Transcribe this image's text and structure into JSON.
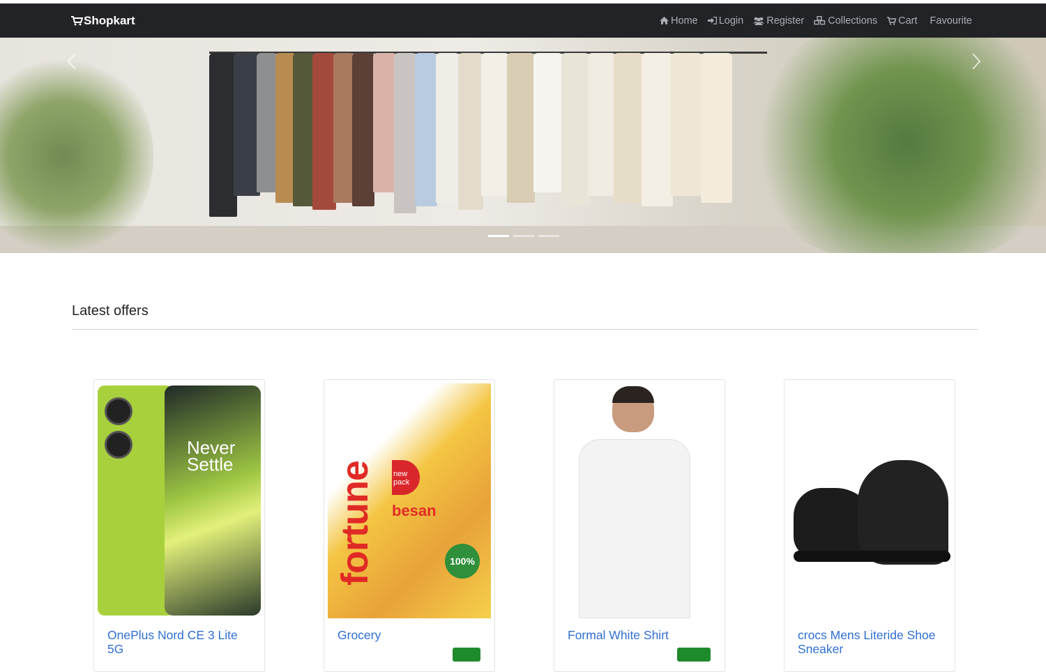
{
  "navbar": {
    "brand": "Shopkart",
    "links": [
      {
        "label": "Home",
        "icon": "home-icon"
      },
      {
        "label": "Login",
        "icon": "login-icon"
      },
      {
        "label": "Register",
        "icon": "users-icon"
      },
      {
        "label": "Collections",
        "icon": "cubes-icon"
      },
      {
        "label": "Cart",
        "icon": "cart-icon"
      },
      {
        "label": "Favourite",
        "icon": ""
      }
    ]
  },
  "carousel": {
    "slide_count": 3,
    "active_index": 0
  },
  "offers": {
    "heading": "Latest offers",
    "products": [
      {
        "title": "OnePlus Nord CE 3 Lite 5G",
        "image": "phone-product-image",
        "has_badge": false
      },
      {
        "title": "Grocery",
        "image": "besan-pack-product-image",
        "has_badge": true
      },
      {
        "title": "Formal White Shirt",
        "image": "white-shirt-product-image",
        "has_badge": true
      },
      {
        "title": "crocs Mens Literide Shoe Sneaker",
        "image": "black-sneaker-product-image",
        "has_badge": false
      }
    ]
  },
  "phone_art": {
    "line1": "Never",
    "line2": "Settle"
  },
  "besan_art": {
    "brand": "fortune",
    "product": "besan",
    "tag": "new pack",
    "seal": "100%"
  },
  "colors": {
    "navbar_bg": "#222326",
    "nav_text": "#a9adb2",
    "link_blue": "#2f6fcf",
    "badge_green": "#1f8a2b"
  }
}
